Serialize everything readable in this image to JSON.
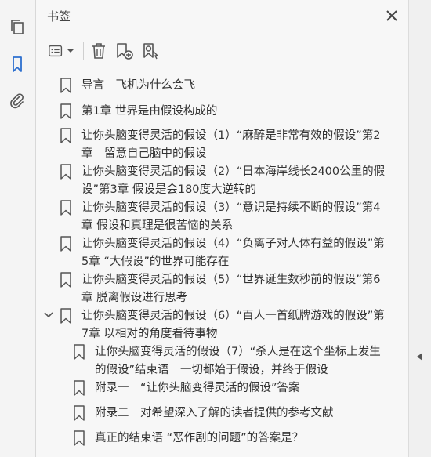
{
  "panel": {
    "title": "书签"
  },
  "bookmarks": [
    {
      "label": "导言　飞机为什么会飞"
    },
    {
      "label": "第1章  世界是由假设构成的"
    },
    {
      "label": "让你头脑变得灵活的假设（1）“麻醉是非常有效的假设”第2章　留意自己脑中的假设"
    },
    {
      "label": "让你头脑变得灵活的假设（2）“日本海岸线长2400公里的假设”第3章  假设是会180度大逆转的"
    },
    {
      "label": "让你头脑变得灵活的假设（3）“意识是持续不断的假设”第4章  假设和真理是很苦恼的关系"
    },
    {
      "label": "让你头脑变得灵活的假设（4）“负离子对人体有益的假设”第5章  “大假设”的世界可能存在"
    },
    {
      "label": "让你头脑变得灵活的假设（5）“世界诞生数秒前的假设”第6章  脱离假设进行思考"
    },
    {
      "label": "让你头脑变得灵活的假设（6）“百人一首纸牌游戏的假设”第7章  以相对的角度看待事物"
    },
    {
      "label": "让你头脑变得灵活的假设（7）“杀人是在这个坐标上发生的假设”结束语　一切都始于假设，并终于假设"
    },
    {
      "label": "附录一　“让你头脑变得灵活的假设”答案"
    },
    {
      "label": "附录二　对希望深入了解的读者提供的参考文献"
    },
    {
      "label": "真正的结束语 “恶作剧的问题”的答案是？"
    }
  ]
}
